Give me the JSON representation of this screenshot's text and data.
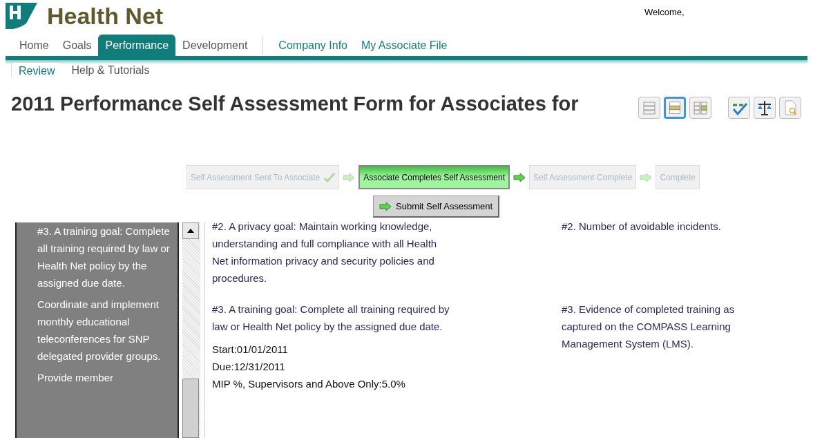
{
  "header": {
    "logo": "Health Net",
    "welcome": "Welcome,"
  },
  "nav": [
    {
      "label": "Home",
      "kind": "main",
      "selected": false
    },
    {
      "label": "Goals",
      "kind": "main",
      "selected": false
    },
    {
      "label": "Performance",
      "kind": "main",
      "selected": true
    },
    {
      "label": "Development",
      "kind": "main",
      "selected": false
    },
    {
      "label": "Company Info",
      "kind": "link",
      "selected": false
    },
    {
      "label": "My Associate File",
      "kind": "link",
      "selected": false
    }
  ],
  "subnav": [
    {
      "label": "Review",
      "selected": true
    },
    {
      "label": "Help & Tutorials",
      "selected": false
    }
  ],
  "title": "2011 Performance Self Assessment Form for Associates for",
  "view_buttons": [
    {
      "kind": "rows",
      "selected": false
    },
    {
      "kind": "single",
      "selected": true
    },
    {
      "kind": "grid",
      "selected": false
    }
  ],
  "tool_buttons": [
    {
      "kind": "spellcheck"
    },
    {
      "kind": "balance"
    },
    {
      "kind": "preview"
    }
  ],
  "workflow": {
    "steps": [
      {
        "label": "Self Assessment Sent To Associate",
        "done": true,
        "selected": false
      },
      {
        "label": "Associate Completes Self Assessment",
        "done": false,
        "selected": true
      },
      {
        "label": "Self Assessment Complete",
        "done": false,
        "selected": false
      },
      {
        "label": "Complete",
        "done": false,
        "selected": false
      }
    ],
    "submit": "Submit Self Assessment"
  },
  "sidebar": {
    "paragraphs": [
      "#3. A training goal: Complete all training required by law or Health Net policy by the assigned due date.",
      "Coordinate and implement monthly educational teleconferences for SNP delegated provider groups.",
      "Provide member"
    ]
  },
  "goals": [
    {
      "description": "#2. A privacy goal: Maintain working knowledge, understanding and full compliance with all Health Net information privacy and security policies and procedures.",
      "measure": "#2. Number of avoidable incidents."
    },
    {
      "description": "#3. A training goal: Complete all training required by law or Health Net policy by the assigned due date.",
      "details": [
        "Start:01/01/2011",
        "Due:12/31/2011",
        "MIP %, Supervisors and Above Only:5.0%"
      ],
      "measure": "#3. Evidence of completed training as captured on the COMPASS Learning Management System (LMS)."
    }
  ]
}
